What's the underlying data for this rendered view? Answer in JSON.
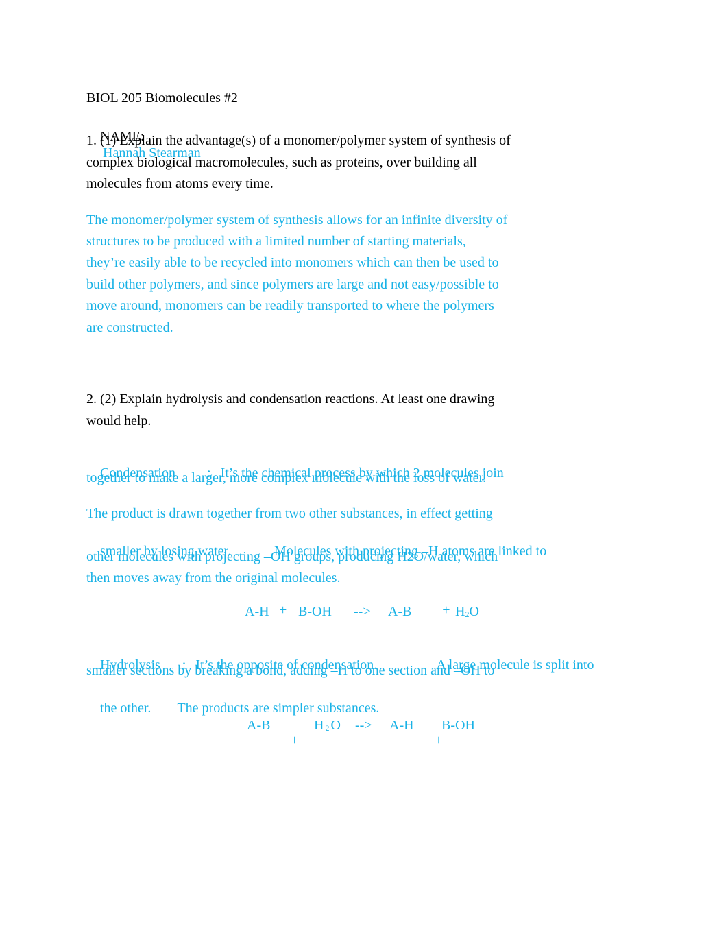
{
  "document": {
    "header": {
      "title": "BIOL 205 Biomolecules #2",
      "name_label": "NAME:",
      "name_value": "Hannah Stearman"
    },
    "question1": {
      "lines": [
        "1. (1) Explain the advantage(s) of a monomer/polymer system of synthesis of",
        "complex biological macromolecules, such as proteins, over building all",
        "molecules from atoms every time."
      ],
      "answer_lines": [
        "The monomer/polymer system of synthesis allows for an infinite diversity of",
        "structures to be produced with a limited number of starting materials,",
        "they’re easily able to be recycled into monomers which can then be used to",
        "build other polymers, and since polymers are large and not easy/possible to",
        "move around, monomers can be readily transported to where the polymers",
        "are constructed."
      ]
    },
    "question2": {
      "lines": [
        "2. (2) Explain hydrolysis and condensation reactions. At least one drawing",
        "would help."
      ],
      "condensation": {
        "term": "Condensation",
        "colon": ":",
        "def_line1": "It’s the chemical process by which 2 molecules join",
        "def_line2": "together to make a larger, more complex molecule with the loss of water.",
        "detail_lines": [
          "The product is drawn together from two other substances, in effect getting",
          "smaller by losing water.",
          "Molecules with projecting –H atoms are linked to",
          "other molecules with projecting –OH groups, producing H2O/water, which",
          "then moves away from the original molecules."
        ],
        "equation": {
          "r1": "A-H",
          "plus1": "+",
          "r2": "B-OH",
          "arrow": "-->",
          "p1": "A-B",
          "plus2": "+",
          "p2_main": "H",
          "p2_sub": "2",
          "p2_end": "O"
        }
      },
      "hydrolysis": {
        "term": "Hydrolysis",
        "colon": ":",
        "def_part1": "It’s the opposite of condensation.",
        "def_part2": "A large molecule is split into",
        "line2": "smaller sections by breaking a bond, adding –H to one section and –OH to",
        "line3_part1": "the other.",
        "line3_part2": "The products are simpler substances.",
        "equation": {
          "r1": "A-B",
          "plus1": "+",
          "r2_main": "H",
          "r2_sub": "2",
          "r2_end": "O",
          "arrow": "-->",
          "p1": "A-H",
          "plus2": "+",
          "p2": "B-OH"
        }
      }
    },
    "colors": {
      "answer_text": "#19b2e6",
      "question_text": "#000000",
      "background": "#ffffff"
    }
  }
}
